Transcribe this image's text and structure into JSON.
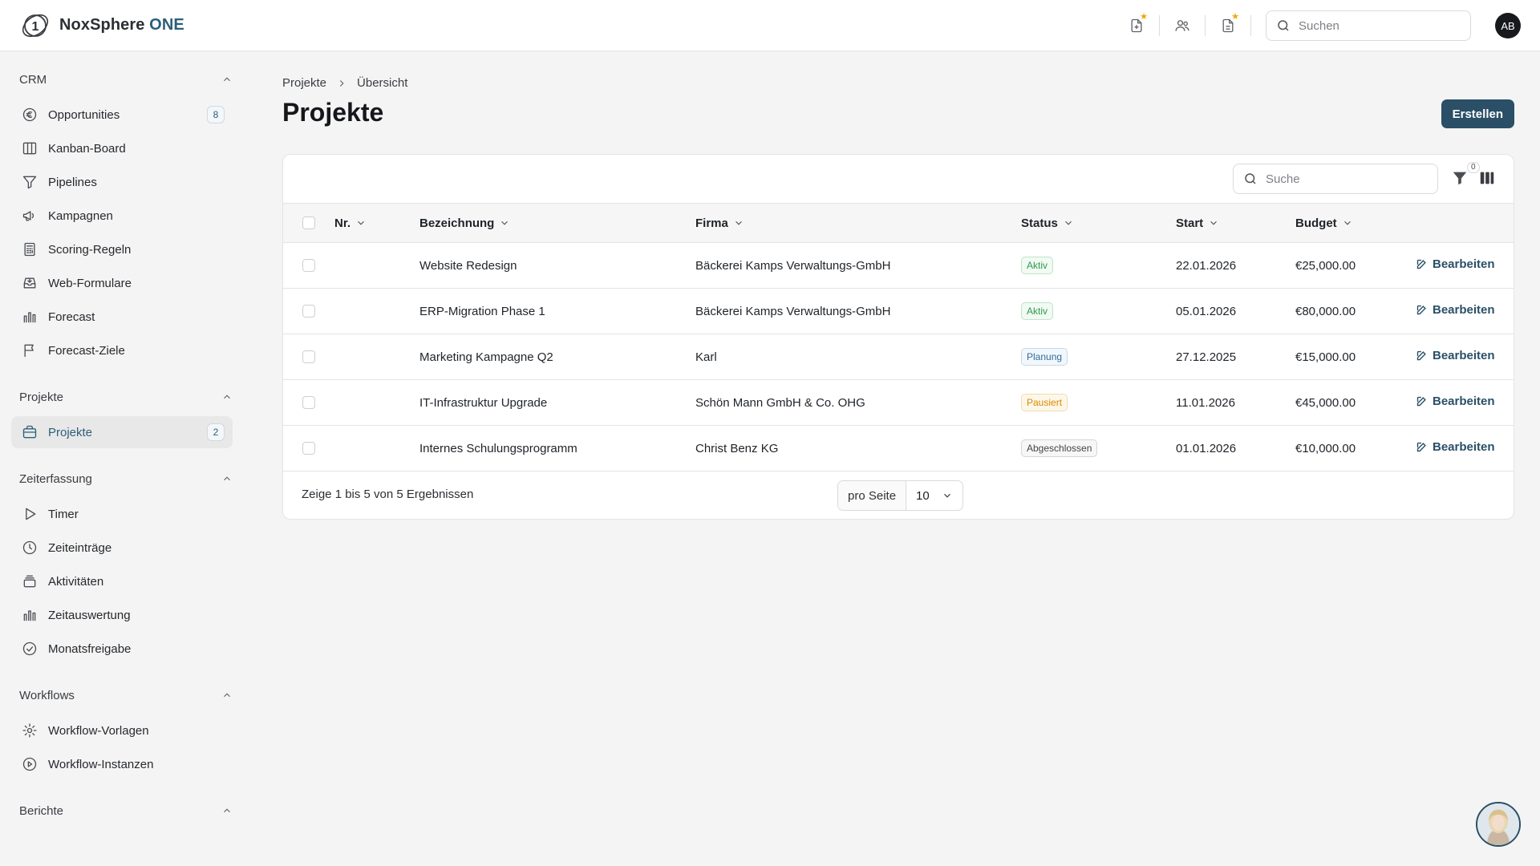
{
  "brand": {
    "name_main": "NoxSphere",
    "name_accent": "ONE",
    "logo_glyph": "1"
  },
  "topbar": {
    "icons": [
      "file-plus-icon",
      "users-icon",
      "document-icon"
    ],
    "search_placeholder": "Suchen",
    "avatar_initials": "AB"
  },
  "sidebar": {
    "sections": [
      {
        "title": "CRM",
        "items": [
          {
            "label": "Opportunities",
            "icon": "euro-icon",
            "badge": "8"
          },
          {
            "label": "Kanban-Board",
            "icon": "columns-icon"
          },
          {
            "label": "Pipelines",
            "icon": "filter-icon"
          },
          {
            "label": "Kampagnen",
            "icon": "megaphone-icon"
          },
          {
            "label": "Scoring-Regeln",
            "icon": "calculator-icon"
          },
          {
            "label": "Web-Formulare",
            "icon": "inbox-icon"
          },
          {
            "label": "Forecast",
            "icon": "bar-chart-icon"
          },
          {
            "label": "Forecast-Ziele",
            "icon": "flag-icon"
          }
        ]
      },
      {
        "title": "Projekte",
        "items": [
          {
            "label": "Projekte",
            "icon": "briefcase-icon",
            "badge": "2",
            "active": true
          }
        ]
      },
      {
        "title": "Zeiterfassung",
        "items": [
          {
            "label": "Timer",
            "icon": "play-icon"
          },
          {
            "label": "Zeiteinträge",
            "icon": "clock-icon"
          },
          {
            "label": "Aktivitäten",
            "icon": "stack-icon"
          },
          {
            "label": "Zeitauswertung",
            "icon": "bar-chart-icon"
          },
          {
            "label": "Monatsfreigabe",
            "icon": "check-circle-icon"
          }
        ]
      },
      {
        "title": "Workflows",
        "items": [
          {
            "label": "Workflow-Vorlagen",
            "icon": "gear-icon"
          },
          {
            "label": "Workflow-Instanzen",
            "icon": "play-circle-icon"
          }
        ]
      },
      {
        "title": "Berichte",
        "items": []
      }
    ]
  },
  "main": {
    "breadcrumb": [
      "Projekte",
      "Übersicht"
    ],
    "title": "Projekte",
    "create_label": "Erstellen",
    "table_search_placeholder": "Suche",
    "filter_count": "0",
    "columns": [
      "Nr.",
      "Bezeichnung",
      "Firma",
      "Status",
      "Start",
      "Budget"
    ],
    "rows": [
      {
        "nr": "",
        "bezeichnung": "Website Redesign",
        "firma": "Bäckerei Kamps Verwaltungs-GmbH",
        "status": "Aktiv",
        "status_kind": "active",
        "start": "22.01.2026",
        "budget": "€25,000.00",
        "action": "Bearbeiten"
      },
      {
        "nr": "",
        "bezeichnung": "ERP-Migration Phase 1",
        "firma": "Bäckerei Kamps Verwaltungs-GmbH",
        "status": "Aktiv",
        "status_kind": "active",
        "start": "05.01.2026",
        "budget": "€80,000.00",
        "action": "Bearbeiten"
      },
      {
        "nr": "",
        "bezeichnung": "Marketing Kampagne Q2",
        "firma": "Karl",
        "status": "Planung",
        "status_kind": "planning",
        "start": "27.12.2025",
        "budget": "€15,000.00",
        "action": "Bearbeiten"
      },
      {
        "nr": "",
        "bezeichnung": "IT-Infrastruktur Upgrade",
        "firma": "Schön Mann GmbH & Co. OHG",
        "status": "Pausiert",
        "status_kind": "paused",
        "start": "11.01.2026",
        "budget": "€45,000.00",
        "action": "Bearbeiten"
      },
      {
        "nr": "",
        "bezeichnung": "Internes Schulungsprogramm",
        "firma": "Christ Benz KG",
        "status": "Abgeschlossen",
        "status_kind": "done",
        "start": "01.01.2026",
        "budget": "€10,000.00",
        "action": "Bearbeiten"
      }
    ],
    "footer": {
      "result_text": "Zeige 1 bis 5 von 5 Ergebnissen",
      "per_page_label": "pro Seite",
      "per_page_value": "10"
    }
  },
  "colors": {
    "accent": "#2a4f66",
    "status_active": "#2e9b4f",
    "status_planning": "#2d6f9e",
    "status_paused": "#d98a00",
    "status_done": "#444444",
    "star": "#f0a500"
  }
}
